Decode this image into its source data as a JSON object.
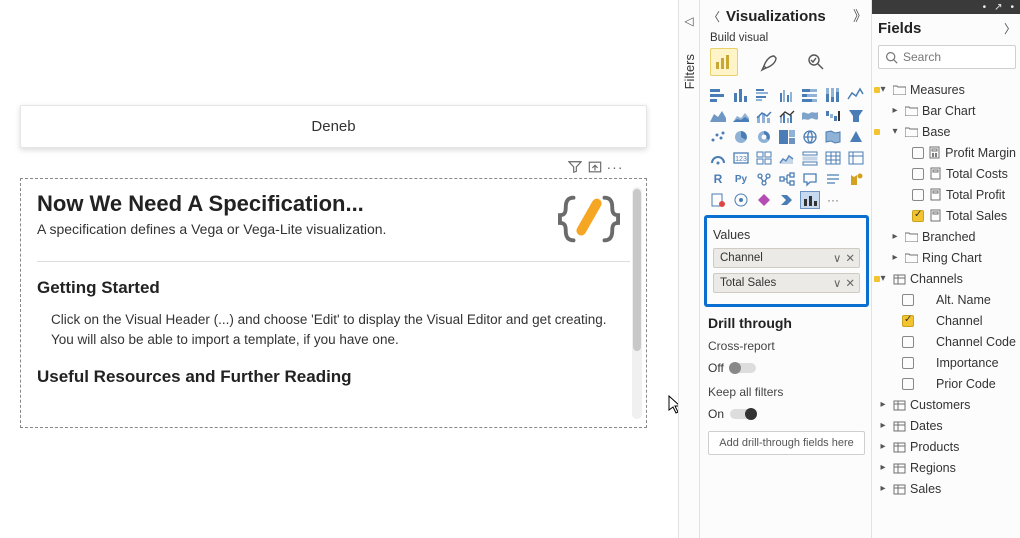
{
  "canvas": {
    "visual_title": "Deneb",
    "spec_heading": "Now We Need A Specification...",
    "spec_sub": "A specification defines a Vega or Vega-Lite visualization.",
    "getting_started": "Getting Started",
    "getting_started_body": "Click on the Visual Header (...) and choose 'Edit' to display the Visual Editor and get creating. You will also be able to import a template, if you have one.",
    "resources": "Useful Resources and Further Reading"
  },
  "filters": {
    "label": "Filters"
  },
  "viz": {
    "title": "Visualizations",
    "build_label": "Build visual",
    "values_label": "Values",
    "fields": {
      "a": "Channel",
      "b": "Total Sales"
    },
    "drill_title": "Drill through",
    "cross_report": "Cross-report",
    "off": "Off",
    "keep_filters": "Keep all filters",
    "on": "On",
    "add_drill": "Add drill-through fields here"
  },
  "fields_pane": {
    "title": "Fields",
    "search_icon": "search-icon",
    "search_placeholder": "Search",
    "tree": {
      "measures": "Measures",
      "bar_chart": "Bar Chart",
      "base": "Base",
      "profit_margin": "Profit Margin",
      "total_costs": "Total Costs",
      "total_profit": "Total Profit",
      "total_sales": "Total Sales",
      "branched": "Branched",
      "ring_chart": "Ring Chart",
      "channels": "Channels",
      "alt_name": "Alt. Name",
      "channel": "Channel",
      "channel_code": "Channel Code",
      "importance": "Importance",
      "prior_code": "Prior Code",
      "customers": "Customers",
      "dates": "Dates",
      "products": "Products",
      "regions": "Regions",
      "sales": "Sales"
    }
  }
}
